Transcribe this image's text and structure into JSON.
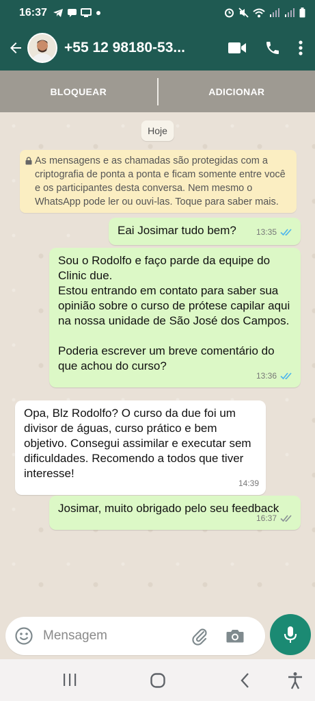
{
  "status_bar": {
    "time": "16:37"
  },
  "header": {
    "contact_name": "+55 12 98180-53..."
  },
  "contact_actions": {
    "block_label": "BLOQUEAR",
    "add_label": "ADICIONAR"
  },
  "chat": {
    "date_chip": "Hoje",
    "encryption_notice": "As mensagens e as chamadas são protegidas com a criptografia de ponta a ponta e ficam somente entre você e os participantes desta conversa. Nem mesmo o WhatsApp pode ler ou ouvi-las. Toque para saber mais.",
    "messages": [
      {
        "direction": "outgoing",
        "text": "Eai Josimar tudo bem?",
        "time": "13:35",
        "status": "read"
      },
      {
        "direction": "outgoing",
        "text": "Sou o Rodolfo e faço parde da equipe do Clinic due.\nEstou entrando em contato para saber sua opinião sobre o curso de prótese capilar aqui na nossa unidade de São José dos Campos.\n\nPoderia escrever um breve comentário do que achou do curso?",
        "time": "13:36",
        "status": "read"
      },
      {
        "direction": "incoming",
        "text": "Opa, Blz Rodolfo? O curso da due foi um divisor de águas, curso prático e bem objetivo. Consegui assimilar e executar sem dificuldades. Recomendo a todos que tiver interesse!",
        "time": "14:39"
      },
      {
        "direction": "outgoing",
        "text": "Josimar, muito obrigado pelo seu feedback",
        "time": "16:37",
        "status": "delivered"
      }
    ]
  },
  "composer": {
    "placeholder": "Mensagem"
  },
  "colors": {
    "header": "#1f5a52",
    "outgoing_bubble": "#dcf8c6",
    "incoming_bubble": "#ffffff",
    "notice": "#fbeec2",
    "read_ticks": "#4fb6ec",
    "mic_button": "#1b8a73"
  },
  "icons": [
    "back-arrow-icon",
    "video-call-icon",
    "phone-icon",
    "more-options-icon",
    "lock-icon",
    "emoji-icon",
    "attach-icon",
    "camera-icon",
    "mic-icon",
    "recent-apps-icon",
    "home-icon",
    "nav-back-icon",
    "accessibility-icon"
  ]
}
